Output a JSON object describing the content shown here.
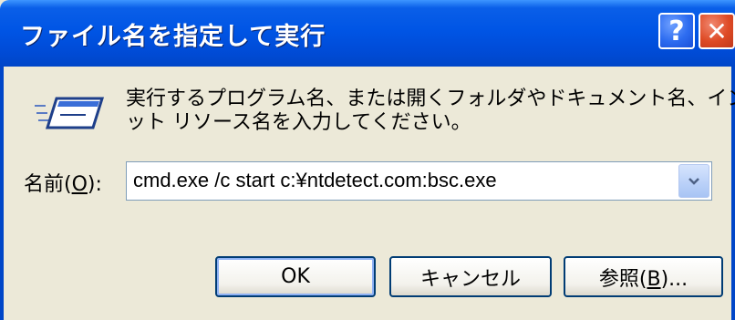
{
  "window": {
    "title": "ファイル名を指定して実行",
    "help_label": "?",
    "close_label": "✕"
  },
  "description": {
    "line1": "実行するプログラム名、または開くフォルダやドキュメント名、インターネ",
    "line2": "ット リソース名を入力してください。"
  },
  "name_field": {
    "label_prefix": "名前(",
    "label_accel": "O",
    "label_suffix": "):",
    "value": "cmd.exe /c start c:¥ntdetect.com:bsc.exe"
  },
  "buttons": {
    "ok": "OK",
    "cancel": "キャンセル",
    "browse_prefix": "参照(",
    "browse_accel": "B",
    "browse_suffix": ")..."
  },
  "colors": {
    "titlebar": "#0055e5",
    "dialog_bg": "#ece9d8",
    "close_btn": "#de4a25",
    "button_border": "#003c74"
  }
}
